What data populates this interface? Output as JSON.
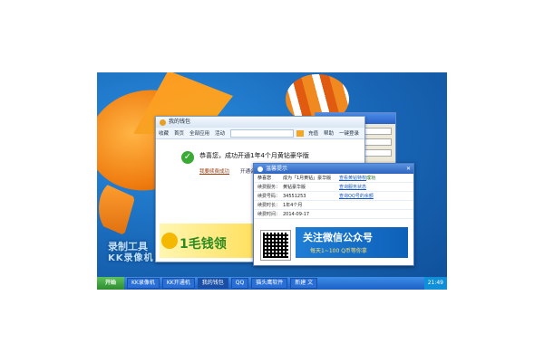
{
  "desktop": {
    "label_line1": "录制工具",
    "label_line2": "KK录像机"
  },
  "back_window": {},
  "main_window": {
    "title": "我的钱包",
    "nav": [
      "收藏",
      "首页",
      "全部应用",
      "活动"
    ],
    "nav_right": [
      "充值",
      "帮助",
      "一键登录"
    ],
    "success_text": "恭喜您，成功开通1年4个月黄钻豪华版",
    "links": [
      "我要续费成功",
      "开通会员"
    ],
    "banner_text": "1毛钱领"
  },
  "popup": {
    "title": "温馨提示",
    "header_key": "恭喜您",
    "header_value": "成为「1月黄钻」豪华版",
    "header_link": "查看黄钻特权",
    "header_status": "成功",
    "rows": [
      {
        "k": "续费服务：",
        "v": "黄钻豪华版",
        "link": "查询服务状态"
      },
      {
        "k": "续费号码：",
        "v": "34551253",
        "link": "查询QQ号的余额"
      },
      {
        "k": "续费时长：",
        "v": "1年4个月",
        "link": ""
      },
      {
        "k": "续费时间：",
        "v": "2014-09-17",
        "link": ""
      }
    ],
    "wechat_title": "关注微信公众号",
    "wechat_sub": "每天1~100 Q币等你拿"
  },
  "taskbar": {
    "start": "开始",
    "buttons": [
      "KK录像机",
      "KK开通机",
      "我的钱包",
      "QQ",
      "猫头鹰软件",
      "新建 文"
    ],
    "tray": "21:49"
  }
}
